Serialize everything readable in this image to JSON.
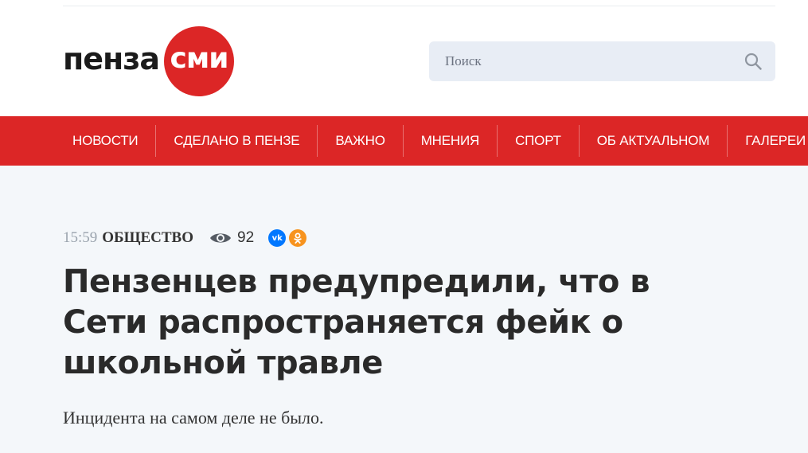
{
  "header": {
    "logo": {
      "word": "пенза",
      "badge": "сми",
      "badge_color": "#dc2626"
    },
    "search": {
      "placeholder": "Поиск",
      "value": "",
      "icon": "search-icon"
    }
  },
  "nav": {
    "background": "#dc2626",
    "items": [
      {
        "label": "НОВОСТИ"
      },
      {
        "label": "СДЕЛАНО В ПЕНЗЕ"
      },
      {
        "label": "ВАЖНО"
      },
      {
        "label": "МНЕНИЯ"
      },
      {
        "label": "СПОРТ"
      },
      {
        "label": "ОБ АКТУАЛЬНОМ"
      },
      {
        "label": "ГАЛЕРЕИ"
      }
    ]
  },
  "article": {
    "time": "15:59",
    "rubric": "ОБЩЕСТВО",
    "views": "92",
    "views_icon": "eye-icon",
    "share": [
      {
        "name": "vk",
        "icon": "vk-icon",
        "color": "#0077ff"
      },
      {
        "name": "ok",
        "icon": "odnoklassniki-icon",
        "color": "#f7931e"
      }
    ],
    "title": "Пензенцев предупредили, что в Сети распространяется фейк о школьной травле",
    "lead": "Инцидента на самом деле не было."
  }
}
